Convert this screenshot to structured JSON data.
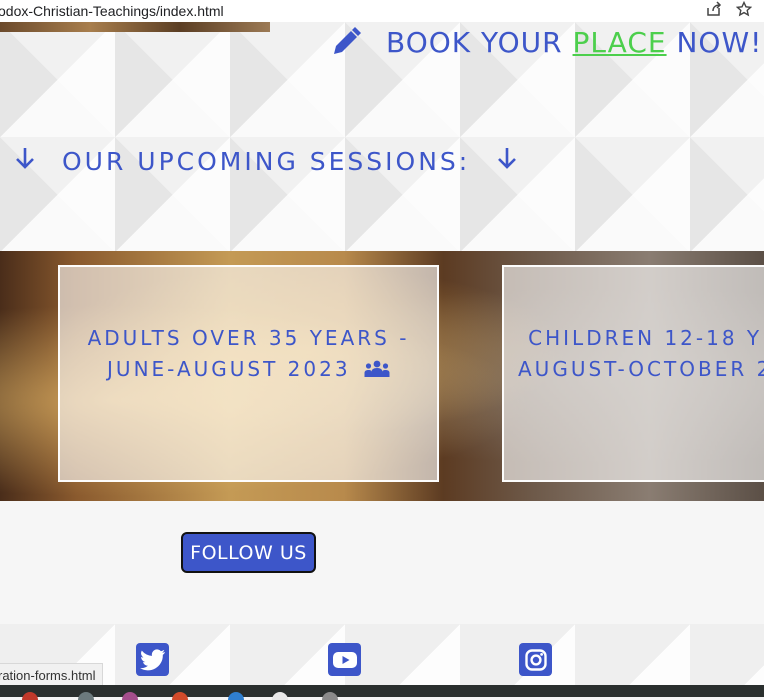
{
  "browser": {
    "url": "odox-Christian-Teachings/index.html",
    "share_icon": "share-icon",
    "bookmark_icon": "star-icon"
  },
  "hero": {
    "book_prefix": "BOOK YOUR",
    "book_link": "PLACE",
    "book_suffix": "NOW!",
    "pencil_icon": "pencil-icon"
  },
  "sessions": {
    "title": "OUR UPCOMING SESSIONS:",
    "arrow_icon": "arrow-down-icon",
    "cards": [
      {
        "line1": "ADULTS OVER 35 YEARS -",
        "line2": "JUNE-AUGUST 2023",
        "icon": "users-icon"
      },
      {
        "line1": "CHILDREN 12-18 Y",
        "line2": "AUGUST-OCTOBER 2"
      }
    ]
  },
  "follow": {
    "button_label": "FOLLOW US"
  },
  "social": {
    "items": [
      "twitter-icon",
      "youtube-icon",
      "instagram-icon"
    ]
  },
  "status": {
    "link_preview": "ration-forms.html"
  },
  "colors": {
    "accent": "#3d56c9",
    "link_green": "#4ccf4c"
  }
}
